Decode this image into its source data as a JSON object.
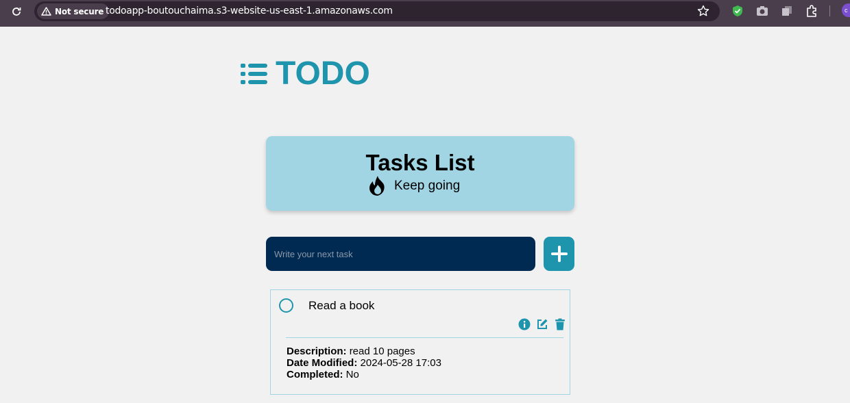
{
  "browser": {
    "security_label": "Not secure",
    "url": "todoapp-boutouchaima.s3-website-us-east-1.amazonaws.com",
    "profile_initial": "c"
  },
  "app": {
    "logo_text": "TODO",
    "accent_color": "#1f94ad"
  },
  "banner": {
    "title": "Tasks List",
    "subtitle": "Keep going"
  },
  "new_task": {
    "placeholder": "Write your next task",
    "value": ""
  },
  "tasks": [
    {
      "title": "Read a book",
      "completed_state": false,
      "description_label": "Description:",
      "description": "read 10 pages",
      "date_label": "Date Modified:",
      "date": "2024-05-28 17:03",
      "completed_label": "Completed:",
      "completed": "No"
    }
  ]
}
